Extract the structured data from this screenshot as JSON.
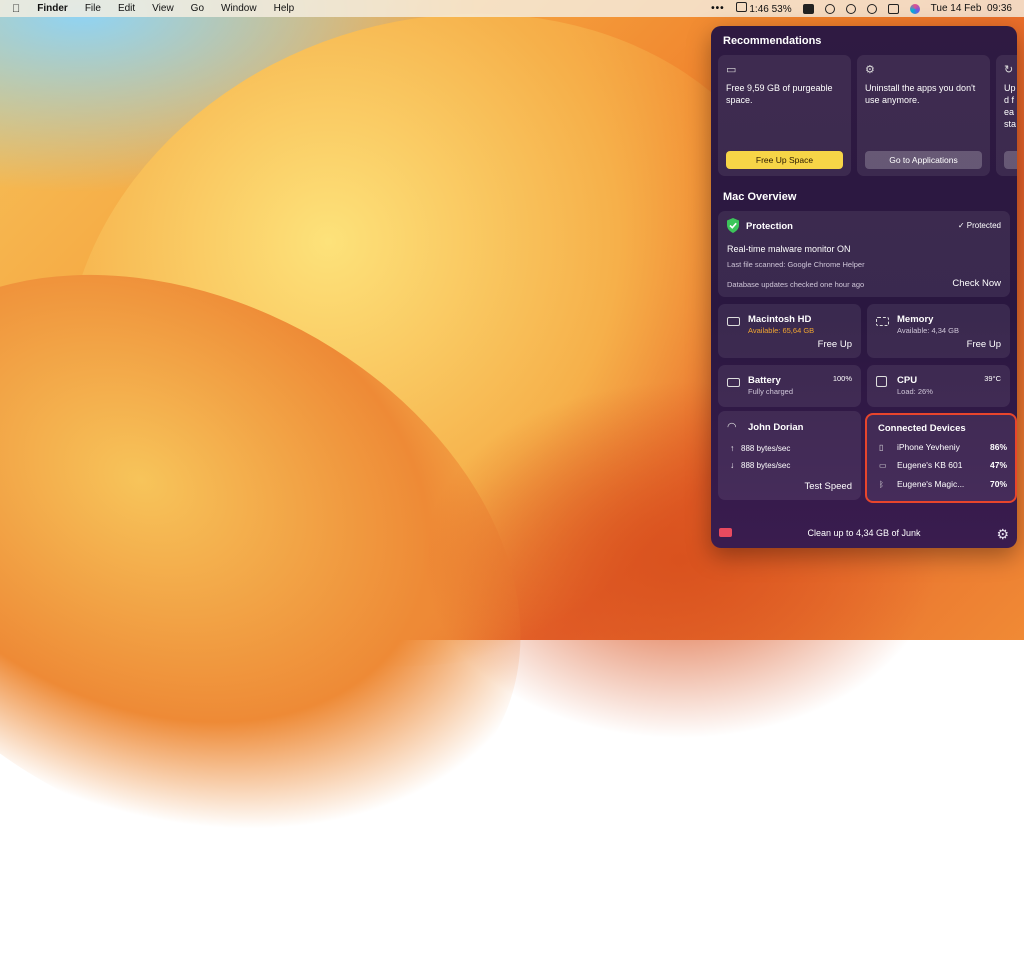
{
  "menubar": {
    "app": "Finder",
    "items": [
      "File",
      "Edit",
      "View",
      "Go",
      "Window",
      "Help"
    ],
    "battery_text": "1:46 53%",
    "datetime": "Tue 14 Feb  09:36"
  },
  "panel": {
    "recommendations_title": "Recommendations",
    "recommendations": [
      {
        "icon": "disk-icon",
        "text": "Free 9,59 GB of purgeable space.",
        "button": "Free Up Space"
      },
      {
        "icon": "apps-icon",
        "text": "Uninstall the apps you don't use anymore.",
        "button": "Go to Applications"
      },
      {
        "icon": "update-icon",
        "text": "Upd fea sta",
        "button": ""
      }
    ],
    "overview_title": "Mac Overview",
    "protection": {
      "title": "Protection",
      "status": "Protected",
      "monitor": "Real-time malware monitor ON",
      "last_file": "Last file scanned: Google Chrome Helper",
      "db": "Database updates checked one hour ago",
      "action": "Check Now"
    },
    "disk": {
      "title": "Macintosh HD",
      "sub": "Available: 65,64 GB",
      "action": "Free Up"
    },
    "memory": {
      "title": "Memory",
      "sub": "Available: 4,34 GB",
      "action": "Free Up"
    },
    "battery": {
      "title": "Battery",
      "sub": "Fully charged",
      "value": "100%"
    },
    "cpu": {
      "title": "CPU",
      "sub": "Load: 26%",
      "value": "39°C"
    },
    "network": {
      "title": "John Dorian",
      "up": "888 bytes/sec",
      "down": "888 bytes/sec",
      "action": "Test Speed"
    },
    "devices": {
      "title": "Connected Devices",
      "items": [
        {
          "name": "iPhone Yevheniy",
          "pct": "86%"
        },
        {
          "name": "Eugene's KB 601",
          "pct": "47%"
        },
        {
          "name": "Eugene's Magic...",
          "pct": "70%"
        }
      ]
    },
    "footer": "Clean up to 4,34 GB of Junk"
  },
  "colors": {
    "accent_yellow": "#f7d547",
    "available_orange": "#f0a531",
    "highlight_red": "#e8452c",
    "protected_green": "#3cc45a"
  }
}
